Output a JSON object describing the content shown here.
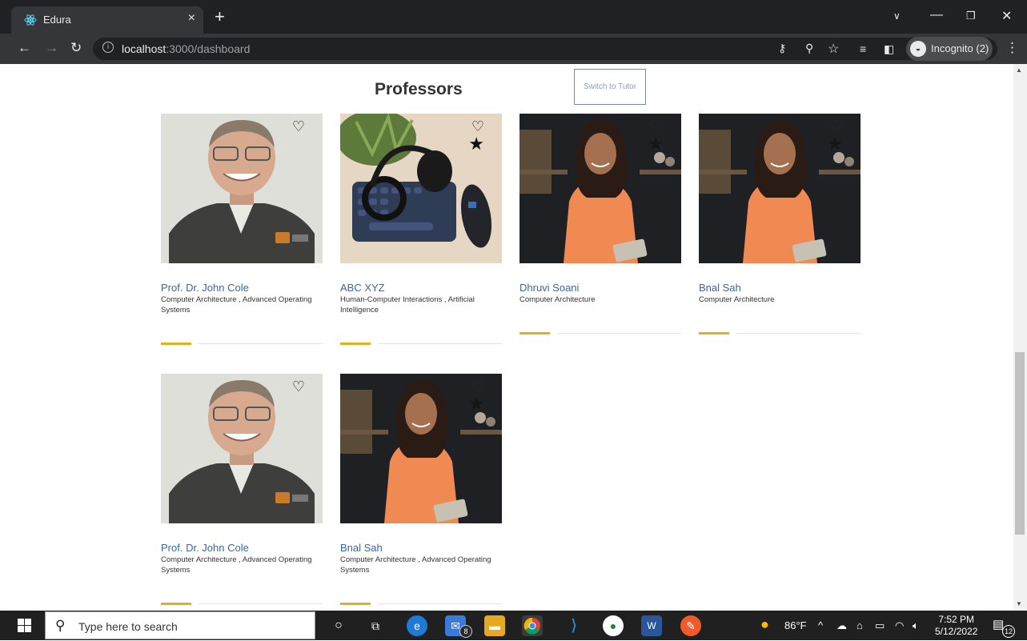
{
  "browser": {
    "tab_title": "Edura",
    "tab_close": "×",
    "new_tab": "+",
    "url_host": "localhost",
    "url_path": ":3000/dashboard",
    "incognito_label": "Incognito (2)"
  },
  "page": {
    "title": "Professors",
    "switch_button": "Switch to Tutor"
  },
  "professors": [
    {
      "name": "Prof. Dr. John Cole",
      "areas": "Computer Architecture , Advanced Operating Systems",
      "photo": "older-man-portrait",
      "favorited": false
    },
    {
      "name": "ABC XYZ",
      "areas": "Human-Computer Interactions , Artificial Intelligence",
      "photo": "headphones-keyboard-mouse",
      "favorited": true
    },
    {
      "name": "Dhruvi Soani",
      "areas": "Computer Architecture",
      "photo": "woman-orange-shirt",
      "favorited": true
    },
    {
      "name": "Bnal Sah",
      "areas": "Computer Architecture",
      "photo": "woman-orange-shirt",
      "favorited": true
    },
    {
      "name": "Prof. Dr. John Cole",
      "areas": "Computer Architecture , Advanced Operating Systems",
      "photo": "older-man-portrait",
      "favorited": false
    },
    {
      "name": "Bnal Sah",
      "areas": "Computer Architecture , Advanced Operating Systems",
      "photo": "woman-orange-shirt",
      "favorited": true
    }
  ],
  "taskbar": {
    "search_placeholder": "Type here to search",
    "mail_badge": "8",
    "weather": "86°F",
    "time": "7:52 PM",
    "date": "5/12/2022",
    "notification_count": "12"
  }
}
